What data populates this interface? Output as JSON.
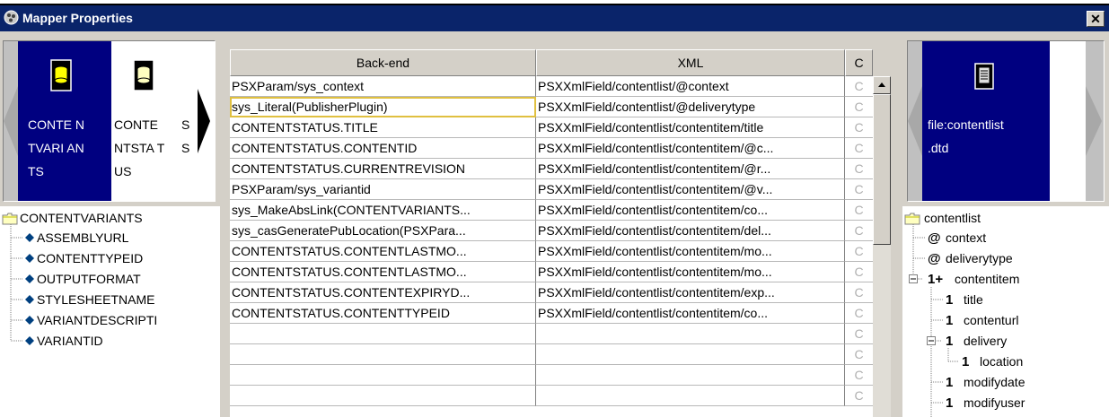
{
  "window": {
    "title": "Mapper Properties",
    "close_label": "✕"
  },
  "left": {
    "datasources": [
      {
        "label": "CONTE NTVARI ANTS",
        "icon": "database-icon",
        "selected": true
      },
      {
        "label": "CONTE NTSTA TUS",
        "icon": "database-icon",
        "selected": false
      },
      {
        "label": "S S",
        "icon": "database-icon",
        "selected": false
      }
    ],
    "tree": {
      "root": "CONTENTVARIANTS",
      "items": [
        "ASSEMBLYURL",
        "CONTENTTYPEID",
        "OUTPUTFORMAT",
        "STYLESHEETNAME",
        "VARIANTDESCRIPTI",
        "VARIANTID"
      ]
    }
  },
  "grid": {
    "columns": [
      "Back-end",
      "XML",
      "C"
    ],
    "rows": [
      {
        "backend": "PSXParam/sys_context",
        "xml": "PSXXmlField/contentlist/@context"
      },
      {
        "backend": "sys_Literal(PublisherPlugin)",
        "xml": "PSXXmlField/contentlist/@deliverytype"
      },
      {
        "backend": "CONTENTSTATUS.TITLE",
        "xml": "PSXXmlField/contentlist/contentitem/title"
      },
      {
        "backend": "CONTENTSTATUS.CONTENTID",
        "xml": "PSXXmlField/contentlist/contentitem/@c..."
      },
      {
        "backend": "CONTENTSTATUS.CURRENTREVISION",
        "xml": "PSXXmlField/contentlist/contentitem/@r..."
      },
      {
        "backend": "PSXParam/sys_variantid",
        "xml": "PSXXmlField/contentlist/contentitem/@v..."
      },
      {
        "backend": "sys_MakeAbsLink(CONTENTVARIANTS...",
        "xml": "PSXXmlField/contentlist/contentitem/co..."
      },
      {
        "backend": "sys_casGeneratePubLocation(PSXPara...",
        "xml": "PSXXmlField/contentlist/contentitem/del..."
      },
      {
        "backend": "CONTENTSTATUS.CONTENTLASTMO...",
        "xml": "PSXXmlField/contentlist/contentitem/mo..."
      },
      {
        "backend": "CONTENTSTATUS.CONTENTLASTMO...",
        "xml": "PSXXmlField/contentlist/contentitem/mo..."
      },
      {
        "backend": "CONTENTSTATUS.CONTENTEXPIRYD...",
        "xml": "PSXXmlField/contentlist/contentitem/exp..."
      },
      {
        "backend": "CONTENTSTATUS.CONTENTTYPEID",
        "xml": "PSXXmlField/contentlist/contentitem/co..."
      },
      {
        "backend": "",
        "xml": ""
      },
      {
        "backend": "",
        "xml": ""
      },
      {
        "backend": "",
        "xml": ""
      },
      {
        "backend": "",
        "xml": ""
      }
    ],
    "check_glyph": "C",
    "selected_row": 1
  },
  "right": {
    "datasource": {
      "label": "file:contentlist .dtd",
      "icon": "dtd-file-icon"
    },
    "tree": {
      "root": "contentlist",
      "nodes": [
        {
          "marker": "@",
          "label": "context",
          "depth": 1,
          "expander": ""
        },
        {
          "marker": "@",
          "label": "deliverytype",
          "depth": 1,
          "expander": ""
        },
        {
          "marker": "1+",
          "label": "contentitem",
          "depth": 1,
          "expander": "minus"
        },
        {
          "marker": "1",
          "label": "title",
          "depth": 2,
          "expander": ""
        },
        {
          "marker": "1",
          "label": "contenturl",
          "depth": 2,
          "expander": ""
        },
        {
          "marker": "1",
          "label": "delivery",
          "depth": 2,
          "expander": "minus"
        },
        {
          "marker": "1",
          "label": "location",
          "depth": 3,
          "expander": ""
        },
        {
          "marker": "1",
          "label": "modifydate",
          "depth": 2,
          "expander": ""
        },
        {
          "marker": "1",
          "label": "modifyuser",
          "depth": 2,
          "expander": ""
        }
      ]
    }
  },
  "colors": {
    "titlebar": "#0a246a",
    "selected": "#000080",
    "panel": "#d4d0c8"
  }
}
